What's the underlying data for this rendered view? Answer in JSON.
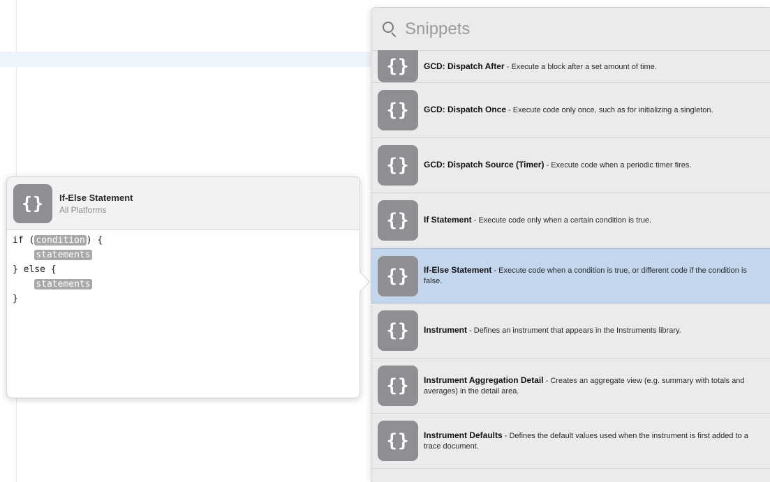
{
  "search": {
    "placeholder": "Snippets",
    "value": ""
  },
  "preview": {
    "title": "If-Else Statement",
    "subtitle": "All Platforms",
    "code": {
      "line1_prefix": "if (",
      "line1_token": "condition",
      "line1_suffix": ") {",
      "line2_token": "statements",
      "line3": "} else {",
      "line4_token": "statements",
      "line5": "}"
    }
  },
  "icon_glyph": "{}",
  "colors": {
    "selection": "#c3d6ec",
    "icon": "#8e8e93",
    "token": "#a8a8a8"
  },
  "snippets": [
    {
      "name": "GCD: Dispatch After",
      "desc": " - Execute a block after a set amount of time."
    },
    {
      "name": "GCD: Dispatch Once",
      "desc": " - Execute code only once, such as for initializing a singleton."
    },
    {
      "name": "GCD: Dispatch Source (Timer)",
      "desc": " - Execute code when a periodic timer fires."
    },
    {
      "name": "If Statement",
      "desc": " - Execute code only when a certain condition is true."
    },
    {
      "name": "If-Else Statement",
      "desc": " - Execute code when a condition is true, or different code if the condition is false."
    },
    {
      "name": "Instrument",
      "desc": " - Defines an instrument that appears in the Instruments library."
    },
    {
      "name": "Instrument Aggregation Detail",
      "desc": " - Creates an aggregate view (e.g. summary with totals and averages) in the detail area."
    },
    {
      "name": "Instrument Defaults",
      "desc": " - Defines the default values used when the instrument is first added to a trace document."
    }
  ]
}
